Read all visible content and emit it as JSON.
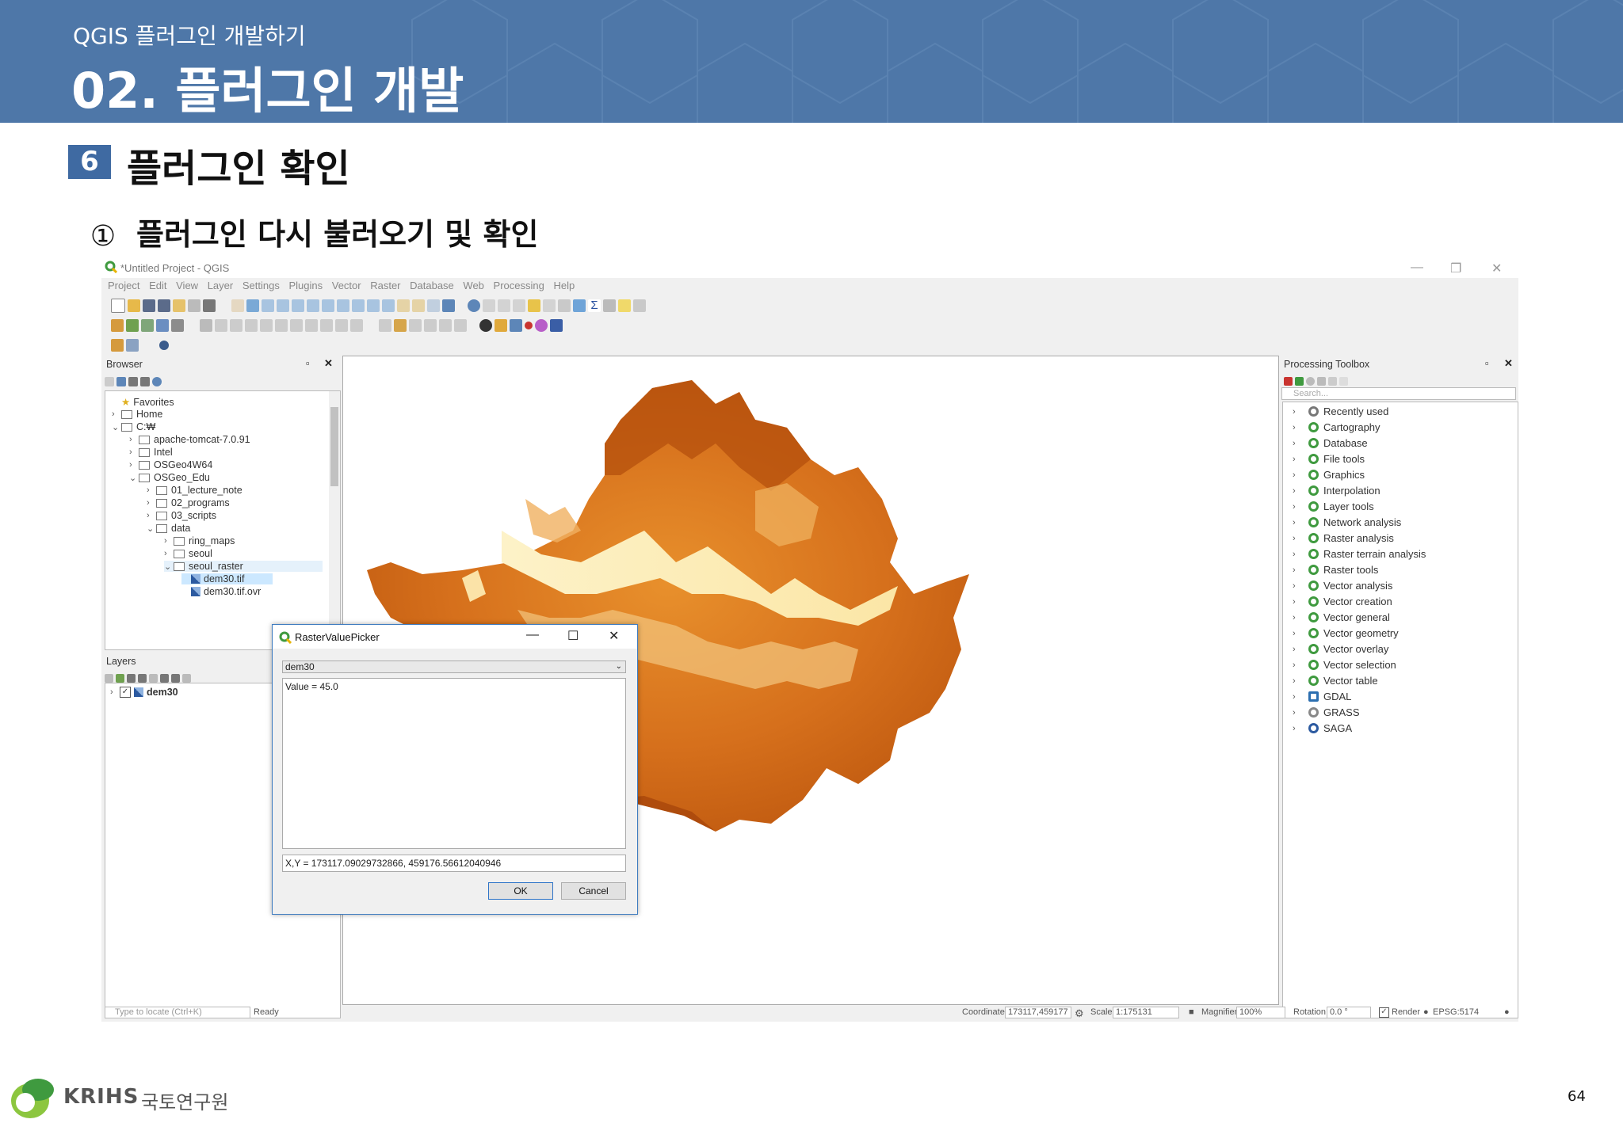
{
  "slide": {
    "subtitle": "QGIS 플러그인 개발하기",
    "title": "02. 플러그인 개발",
    "section_number": "6",
    "section_title": "플러그인 확인",
    "step_marker": "①",
    "step_text": "플러그인 다시 불러오기 및 확인",
    "org_name": "KRIHS",
    "org_name_kr": "국토연구원",
    "page_number": "64",
    "banner_color": "#4e77a8"
  },
  "qgis": {
    "window_title": "*Untitled Project - QGIS",
    "menu": [
      "Project",
      "Edit",
      "View",
      "Layer",
      "Settings",
      "Plugins",
      "Vector",
      "Raster",
      "Database",
      "Web",
      "Processing",
      "Help"
    ],
    "browser": {
      "title": "Browser",
      "items": [
        {
          "label": "Favorites",
          "icon": "star-icon"
        },
        {
          "label": "Home",
          "icon": "home-icon"
        },
        {
          "label": "C:₩",
          "icon": "folder-icon"
        },
        {
          "label": "apache-tomcat-7.0.91",
          "icon": "folder-icon"
        },
        {
          "label": "Intel",
          "icon": "folder-icon"
        },
        {
          "label": "OSGeo4W64",
          "icon": "folder-icon"
        },
        {
          "label": "OSGeo_Edu",
          "icon": "folder-icon"
        },
        {
          "label": "01_lecture_note",
          "icon": "folder-icon"
        },
        {
          "label": "02_programs",
          "icon": "folder-icon"
        },
        {
          "label": "03_scripts",
          "icon": "folder-icon"
        },
        {
          "label": "data",
          "icon": "folder-icon"
        },
        {
          "label": "ring_maps",
          "icon": "folder-icon"
        },
        {
          "label": "seoul",
          "icon": "folder-icon"
        },
        {
          "label": "seoul_raster",
          "icon": "folder-icon"
        },
        {
          "label": "dem30.tif",
          "icon": "raster-icon"
        },
        {
          "label": "dem30.tif.ovr",
          "icon": "raster-icon"
        }
      ]
    },
    "layers": {
      "title": "Layers",
      "items": [
        {
          "label": "dem30",
          "checked": true
        }
      ]
    },
    "toolbox": {
      "title": "Processing Toolbox",
      "search_placeholder": "Search...",
      "items": [
        "Recently used",
        "Cartography",
        "Database",
        "File tools",
        "Graphics",
        "Interpolation",
        "Layer tools",
        "Network analysis",
        "Raster analysis",
        "Raster terrain analysis",
        "Raster tools",
        "Vector analysis",
        "Vector creation",
        "Vector general",
        "Vector geometry",
        "Vector overlay",
        "Vector selection",
        "Vector table",
        "GDAL",
        "GRASS",
        "SAGA"
      ]
    },
    "statusbar": {
      "locate_placeholder": "Type to locate (Ctrl+K)",
      "status": "Ready",
      "coordinate_label": "Coordinate",
      "coordinate_value": "173117,459177",
      "scale_label": "Scale",
      "scale_value": "1:175131",
      "magnifier_label": "Magnifier",
      "magnifier_value": "100%",
      "rotation_label": "Rotation",
      "rotation_value": "0.0 °",
      "render_label": "Render",
      "crs": "EPSG:5174"
    }
  },
  "dialog": {
    "title": "RasterValuePicker",
    "layer": "dem30",
    "value_text": "Value = 45.0",
    "xy_text": "X,Y = 173117.09029732866, 459176.56612040946",
    "ok_label": "OK",
    "cancel_label": "Cancel"
  }
}
